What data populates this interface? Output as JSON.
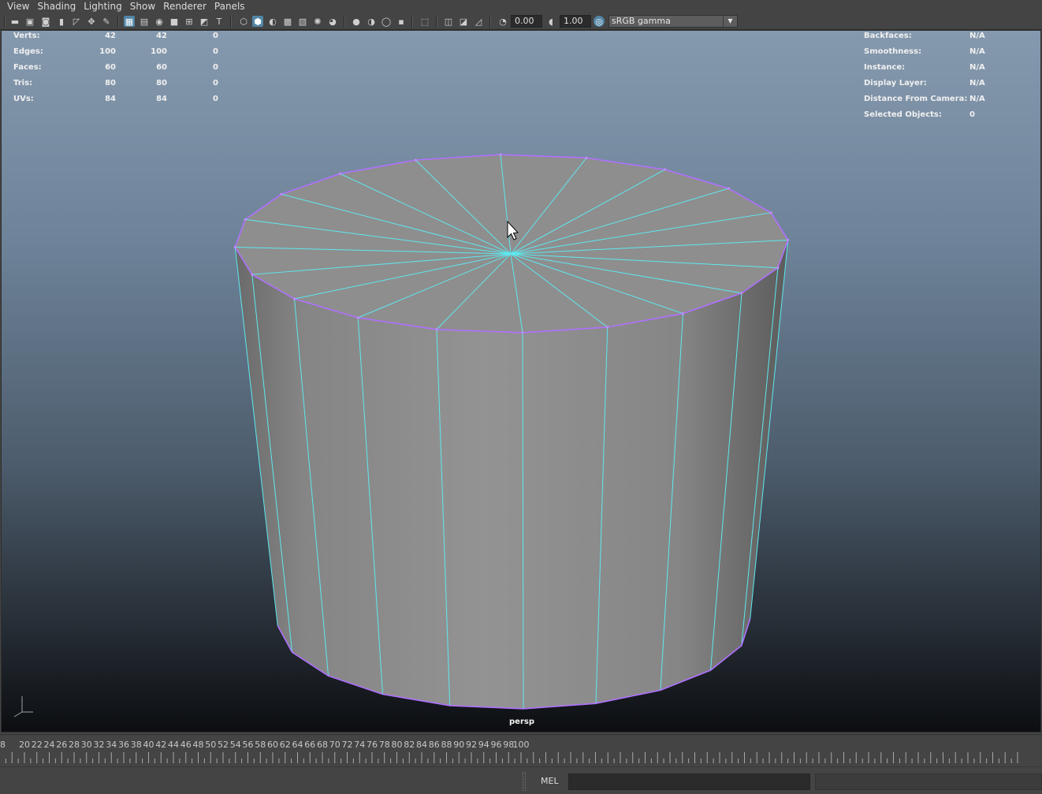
{
  "menubar": {
    "items": [
      "View",
      "Shading",
      "Lighting",
      "Show",
      "Renderer",
      "Panels"
    ]
  },
  "toolbar": {
    "exposure_value": "0.00",
    "gamma_value": "1.00",
    "color_space": "sRGB gamma",
    "active_color": "#5285a6",
    "icons": [
      "camera-icon",
      "camera-attributes-icon",
      "bookmark-icon",
      "image-plane-icon",
      "grid-icon",
      "film-gate-icon",
      "resolution-gate-icon",
      "safe-action-icon",
      "wireframe-icon",
      "smooth-shade-icon",
      "shadows-icon",
      "lights-icon",
      "xray-icon",
      "isolate-icon",
      "exposure-icon",
      "gamma-icon",
      "color-management-icon"
    ]
  },
  "hud_left": {
    "rows": [
      {
        "label": "Verts:",
        "v1": "42",
        "v2": "42",
        "v3": "0"
      },
      {
        "label": "Edges:",
        "v1": "100",
        "v2": "100",
        "v3": "0"
      },
      {
        "label": "Faces:",
        "v1": "60",
        "v2": "60",
        "v3": "0"
      },
      {
        "label": "Tris:",
        "v1": "80",
        "v2": "80",
        "v3": "0"
      },
      {
        "label": "UVs:",
        "v1": "84",
        "v2": "84",
        "v3": "0"
      }
    ]
  },
  "hud_right": {
    "rows": [
      {
        "label": "Backfaces:",
        "value": "N/A"
      },
      {
        "label": "Smoothness:",
        "value": "N/A"
      },
      {
        "label": "Instance:",
        "value": "N/A"
      },
      {
        "label": "Display Layer:",
        "value": "N/A"
      },
      {
        "label": "Distance From Camera:",
        "value": "N/A"
      },
      {
        "label": "Selected Objects:",
        "value": "0"
      }
    ]
  },
  "viewport": {
    "camera_label": "persp",
    "mesh_color": "#8e8e8e",
    "wire_color": "#5ee8f0",
    "border_color": "#b070ff"
  },
  "timeline": {
    "start_label": "8",
    "labels": [
      "20",
      "22",
      "24",
      "26",
      "28",
      "30",
      "32",
      "34",
      "36",
      "38",
      "40",
      "42",
      "44",
      "46",
      "48",
      "50",
      "52",
      "54",
      "56",
      "58",
      "60",
      "62",
      "64",
      "66",
      "68",
      "70",
      "72",
      "74",
      "76",
      "78",
      "80",
      "82",
      "84",
      "86",
      "88",
      "90",
      "92",
      "94",
      "96",
      "98",
      "100"
    ]
  },
  "command_line": {
    "language": "MEL"
  }
}
